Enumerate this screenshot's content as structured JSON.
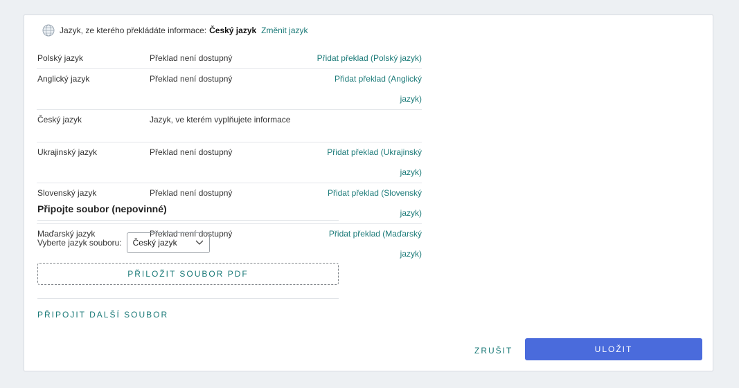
{
  "source_language": {
    "label": "Jazyk, ze kterého překládáte informace:",
    "current": "Český jazyk",
    "change_link": "Změnit jazyk"
  },
  "translations": [
    {
      "language": "Polský jazyk",
      "status": "Překlad není dostupný",
      "action": "Přidat překlad (Polský jazyk)"
    },
    {
      "language": "Anglický jazyk",
      "status": "Překlad není dostupný",
      "action": "Přidat překlad (Anglický jazyk)"
    },
    {
      "language": "Český jazyk",
      "status": "Jazyk, ve kterém vyplňujete informace",
      "action": ""
    },
    {
      "language": "Ukrajinský jazyk",
      "status": "Překlad není dostupný",
      "action": "Přidat překlad (Ukrajinský jazyk)"
    },
    {
      "language": "Slovenský jazyk",
      "status": "Překlad není dostupný",
      "action": "Přidat překlad (Slovenský jazyk)"
    },
    {
      "language": "Maďarský jazyk",
      "status": "Překlad není dostupný",
      "action": "Přidat překlad (Maďarský jazyk)"
    }
  ],
  "attachment": {
    "title": "Připojte soubor (nepovinné)",
    "file_language_label": "Vyberte jazyk souboru:",
    "file_language_value": "Český jazyk",
    "attach_pdf_button": "PŘILOŽIT SOUBOR PDF",
    "add_another_file": "PŘIPOJIT DALŠÍ SOUBOR"
  },
  "footer": {
    "cancel": "ZRUŠIT",
    "save": "ULOŽIT"
  },
  "colors": {
    "link": "#1b7a78",
    "primary": "#4a6bdc",
    "background": "#edf0f3"
  },
  "icons": {
    "globe": "globe-icon",
    "select_arrow": "chevron-down-icon"
  }
}
